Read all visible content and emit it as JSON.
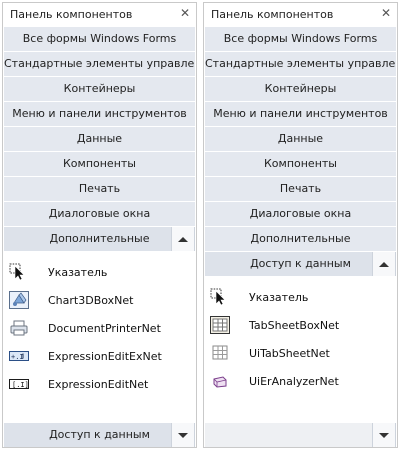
{
  "panels": [
    {
      "title": "Панель компонентов",
      "categories_top": [
        "Все формы Windows Forms",
        "Стандартные элементы управления",
        "Контейнеры",
        "Меню и панели инструментов",
        "Данные",
        "Компоненты",
        "Печать",
        "Диалоговые окна",
        "Дополнительные"
      ],
      "tools": [
        {
          "label": "Указатель",
          "icon": "pointer-icon"
        },
        {
          "label": "Chart3DBoxNet",
          "icon": "chart3d-icon"
        },
        {
          "label": "DocumentPrinterNet",
          "icon": "printer-icon"
        },
        {
          "label": "ExpressionEditExNet",
          "icon": "expression-editor-ex-icon"
        },
        {
          "label": "ExpressionEditNet",
          "icon": "expression-editor-icon"
        }
      ],
      "categories_bottom": [
        "Доступ к данным"
      ]
    },
    {
      "title": "Панель компонентов",
      "categories_top": [
        "Все формы Windows Forms",
        "Стандартные элементы управления",
        "Контейнеры",
        "Меню и панели инструментов",
        "Данные",
        "Компоненты",
        "Печать",
        "Диалоговые окна",
        "Дополнительные",
        "Доступ к данным"
      ],
      "tools": [
        {
          "label": "Указатель",
          "icon": "pointer-icon"
        },
        {
          "label": "TabSheetBoxNet",
          "icon": "tabsheet-icon"
        },
        {
          "label": "UiTabSheetNet",
          "icon": "ui-tabsheet-icon"
        },
        {
          "label": "UiErAnalyzerNet",
          "icon": "er-analyzer-icon"
        }
      ],
      "categories_bottom": []
    }
  ]
}
